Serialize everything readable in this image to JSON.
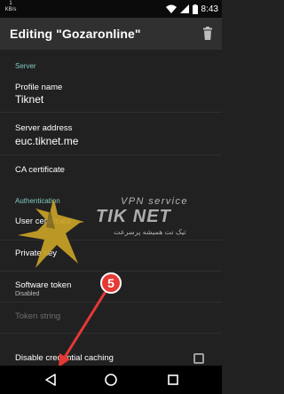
{
  "status_bar": {
    "net_speed_value": "1",
    "net_speed_unit": "KB/s",
    "time": "8:43",
    "icons": [
      "wifi-icon",
      "cellular-signal-icon",
      "battery-icon"
    ]
  },
  "app_bar": {
    "title": "Editing \"Gozaronline\"",
    "delete_icon": "trash-icon"
  },
  "preferences": {
    "server_category": "Server",
    "profile_name_title": "Profile name",
    "profile_name_value": "Tiknet",
    "server_address_title": "Server address",
    "server_address_value": "euc.tiknet.me",
    "ca_certificate_title": "CA certificate",
    "authentication_category": "Authentication",
    "user_certificate_title": "User certificate",
    "private_key_title": "Private key",
    "software_token_title": "Software token",
    "software_token_summary": "Disabled",
    "token_string_title": "Token string",
    "disable_caching_title": "Disable credential caching"
  },
  "watermark": {
    "line1": "VPN service",
    "line2": "TIK NET",
    "line3": "تیک نت همیشه پرسرعت"
  },
  "annotation": {
    "step_number": "5"
  },
  "colors": {
    "category_accent": "#80cbc4",
    "badge_red": "#e53935",
    "logo_gold": "#c9a227"
  },
  "nav_bar": {
    "icons": [
      "back-icon",
      "home-icon",
      "recents-icon"
    ]
  }
}
